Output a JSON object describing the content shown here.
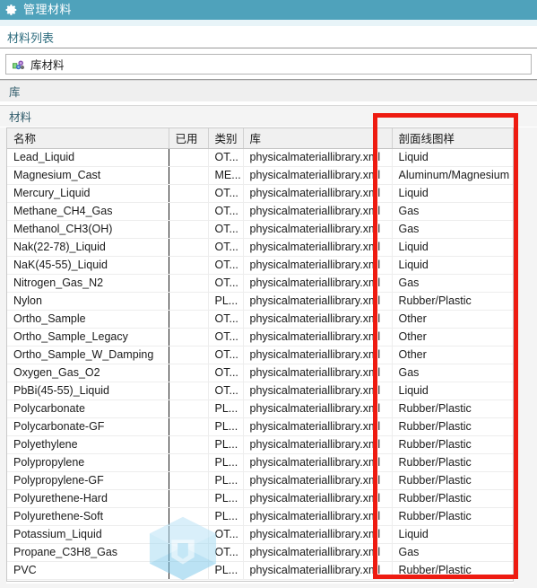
{
  "window": {
    "title": "管理材料",
    "title_icon": "gear-icon",
    "accent_color": "#4fa2bb",
    "annotation_color": "#ee1b11"
  },
  "panel": {
    "heading": "材料列表"
  },
  "library_selector": {
    "icon": "library-materials-icon",
    "value": "库材料"
  },
  "group_headers": [
    {
      "label": "库"
    },
    {
      "label": "材料"
    }
  ],
  "table": {
    "columns": [
      {
        "key": "name",
        "label": "名称"
      },
      {
        "key": "used",
        "label": "已用"
      },
      {
        "key": "cat",
        "label": "类别"
      },
      {
        "key": "lib",
        "label": "库"
      },
      {
        "key": "hatch",
        "label": "剖面线图样"
      }
    ],
    "rows": [
      {
        "name": "Lead_Liquid",
        "used": "",
        "cat": "OT...",
        "lib": "physicalmateriallibrary.xml",
        "hatch": "Liquid"
      },
      {
        "name": "Magnesium_Cast",
        "used": "",
        "cat": "ME...",
        "lib": "physicalmateriallibrary.xml",
        "hatch": "Aluminum/Magnesium"
      },
      {
        "name": "Mercury_Liquid",
        "used": "",
        "cat": "OT...",
        "lib": "physicalmateriallibrary.xml",
        "hatch": "Liquid"
      },
      {
        "name": "Methane_CH4_Gas",
        "used": "",
        "cat": "OT...",
        "lib": "physicalmateriallibrary.xml",
        "hatch": "Gas"
      },
      {
        "name": "Methanol_CH3(OH)",
        "used": "",
        "cat": "OT...",
        "lib": "physicalmateriallibrary.xml",
        "hatch": "Gas"
      },
      {
        "name": "Nak(22-78)_Liquid",
        "used": "",
        "cat": "OT...",
        "lib": "physicalmateriallibrary.xml",
        "hatch": "Liquid"
      },
      {
        "name": "NaK(45-55)_Liquid",
        "used": "",
        "cat": "OT...",
        "lib": "physicalmateriallibrary.xml",
        "hatch": "Liquid"
      },
      {
        "name": "Nitrogen_Gas_N2",
        "used": "",
        "cat": "OT...",
        "lib": "physicalmateriallibrary.xml",
        "hatch": "Gas"
      },
      {
        "name": "Nylon",
        "used": "",
        "cat": "PL...",
        "lib": "physicalmateriallibrary.xml",
        "hatch": "Rubber/Plastic"
      },
      {
        "name": "Ortho_Sample",
        "used": "",
        "cat": "OT...",
        "lib": "physicalmateriallibrary.xml",
        "hatch": "Other"
      },
      {
        "name": "Ortho_Sample_Legacy",
        "used": "",
        "cat": "OT...",
        "lib": "physicalmateriallibrary.xml",
        "hatch": "Other"
      },
      {
        "name": "Ortho_Sample_W_Damping",
        "used": "",
        "cat": "OT...",
        "lib": "physicalmateriallibrary.xml",
        "hatch": "Other"
      },
      {
        "name": "Oxygen_Gas_O2",
        "used": "",
        "cat": "OT...",
        "lib": "physicalmateriallibrary.xml",
        "hatch": "Gas"
      },
      {
        "name": "PbBi(45-55)_Liquid",
        "used": "",
        "cat": "OT...",
        "lib": "physicalmateriallibrary.xml",
        "hatch": "Liquid"
      },
      {
        "name": "Polycarbonate",
        "used": "",
        "cat": "PL...",
        "lib": "physicalmateriallibrary.xml",
        "hatch": "Rubber/Plastic"
      },
      {
        "name": "Polycarbonate-GF",
        "used": "",
        "cat": "PL...",
        "lib": "physicalmateriallibrary.xml",
        "hatch": "Rubber/Plastic"
      },
      {
        "name": "Polyethylene",
        "used": "",
        "cat": "PL...",
        "lib": "physicalmateriallibrary.xml",
        "hatch": "Rubber/Plastic"
      },
      {
        "name": "Polypropylene",
        "used": "",
        "cat": "PL...",
        "lib": "physicalmateriallibrary.xml",
        "hatch": "Rubber/Plastic"
      },
      {
        "name": "Polypropylene-GF",
        "used": "",
        "cat": "PL...",
        "lib": "physicalmateriallibrary.xml",
        "hatch": "Rubber/Plastic"
      },
      {
        "name": "Polyurethene-Hard",
        "used": "",
        "cat": "PL...",
        "lib": "physicalmateriallibrary.xml",
        "hatch": "Rubber/Plastic"
      },
      {
        "name": "Polyurethene-Soft",
        "used": "",
        "cat": "PL...",
        "lib": "physicalmateriallibrary.xml",
        "hatch": "Rubber/Plastic"
      },
      {
        "name": "Potassium_Liquid",
        "used": "",
        "cat": "OT...",
        "lib": "physicalmateriallibrary.xml",
        "hatch": "Liquid"
      },
      {
        "name": "Propane_C3H8_Gas",
        "used": "",
        "cat": "OT...",
        "lib": "physicalmateriallibrary.xml",
        "hatch": "Gas"
      },
      {
        "name": "PVC",
        "used": "",
        "cat": "PL...",
        "lib": "physicalmateriallibrary.xml",
        "hatch": "Rubber/Plastic"
      }
    ]
  },
  "watermark": {
    "icon": "hexagon-logo-watermark",
    "color": "#7ec8ea"
  }
}
